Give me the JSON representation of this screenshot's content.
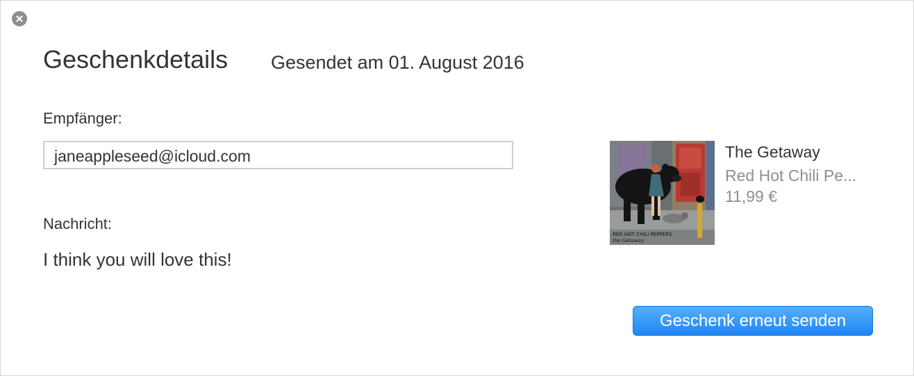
{
  "dialog": {
    "title": "Geschenkdetails",
    "sent_date": "Gesendet am 01. August 2016",
    "close_icon": "close-icon"
  },
  "recipient": {
    "label": "Empfänger:",
    "value": "janeappleseed@icloud.com"
  },
  "message": {
    "label": "Nachricht:",
    "text": "I think you will love this!"
  },
  "product": {
    "title": "The Getaway",
    "artist": "Red Hot Chili Pe...",
    "price": "11,99 €",
    "cover_text_line1": "RED HOT CHILI PEPPERS",
    "cover_text_line2": "the Getaway"
  },
  "actions": {
    "resend_label": "Geschenk erneut senden"
  },
  "colors": {
    "accent": "#1f86f5",
    "muted_text": "#8e8e93",
    "text": "#333333"
  }
}
